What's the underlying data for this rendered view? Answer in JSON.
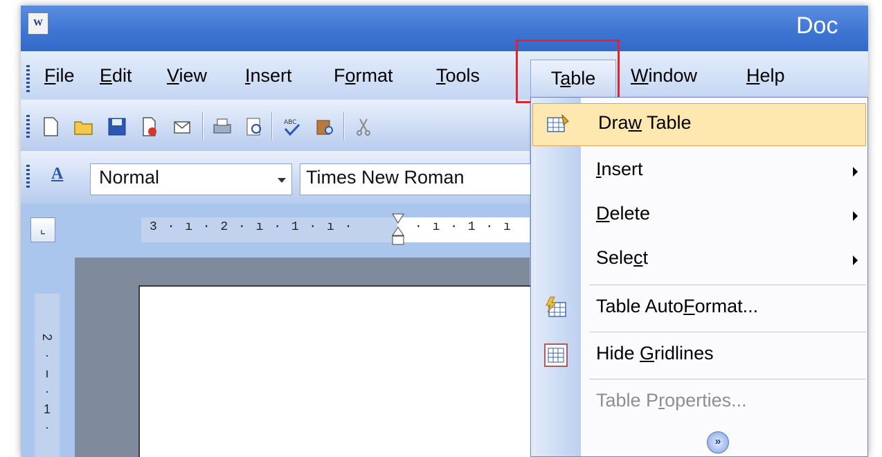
{
  "titlebar": {
    "title": "Doc"
  },
  "menu": {
    "items": [
      {
        "label": "File",
        "underline": "F"
      },
      {
        "label": "Edit",
        "underline": "E"
      },
      {
        "label": "View",
        "underline": "V"
      },
      {
        "label": "Insert",
        "underline": "I"
      },
      {
        "label": "Format",
        "underline": "o"
      },
      {
        "label": "Tools",
        "underline": "T"
      },
      {
        "label": "Table",
        "underline": "a"
      },
      {
        "label": "Window",
        "underline": "W"
      },
      {
        "label": "Help",
        "underline": "H"
      }
    ],
    "active": "Table",
    "highlight_color": "#e0242a"
  },
  "formatting": {
    "style": "Normal",
    "font": "Times New Roman"
  },
  "ruler": {
    "horizontal": "3 · ı · 2 · ı · 1 · ı ·",
    "horizontal_right": "· ı · 1 · ı",
    "vertical": [
      "2",
      "·",
      "ı",
      "·",
      "1",
      "·"
    ]
  },
  "table_menu": {
    "items": [
      {
        "label": "Draw Table",
        "underline": "w",
        "icon": "draw-table-icon",
        "highlighted": true
      },
      {
        "label": "Insert",
        "underline": "I",
        "submenu": true
      },
      {
        "label": "Delete",
        "underline": "D",
        "submenu": true
      },
      {
        "label": "Select",
        "underline": "c",
        "submenu": true
      },
      {
        "label": "Table AutoFormat...",
        "underline": "F",
        "icon": "autoformat-icon"
      },
      {
        "label": "Hide Gridlines",
        "underline": "G",
        "icon": "gridlines-icon"
      },
      {
        "label": "Table Properties...",
        "underline": "r",
        "disabled": true
      }
    ],
    "expand_icon": "chevron-double-down-icon"
  },
  "colors": {
    "titlebar": "#3f76d3",
    "menu_highlight": "#ffe8b0",
    "menu_highlight_border": "#e0a649"
  }
}
